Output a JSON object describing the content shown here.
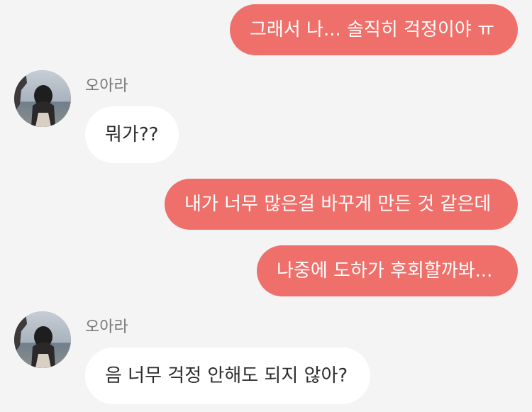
{
  "messages": [
    {
      "text": "그래서 나... 솔직히 걱정이야 ㅠ"
    },
    {
      "sender": "오아라",
      "text": "뭐가??"
    },
    {
      "text": "내가 너무 많은걸 바꾸게 만든 것 같은데"
    },
    {
      "text": "나중에 도하가 후회할까봐..."
    },
    {
      "sender": "오아라",
      "text": "음 너무 걱정 안해도 되지 않아?"
    }
  ]
}
